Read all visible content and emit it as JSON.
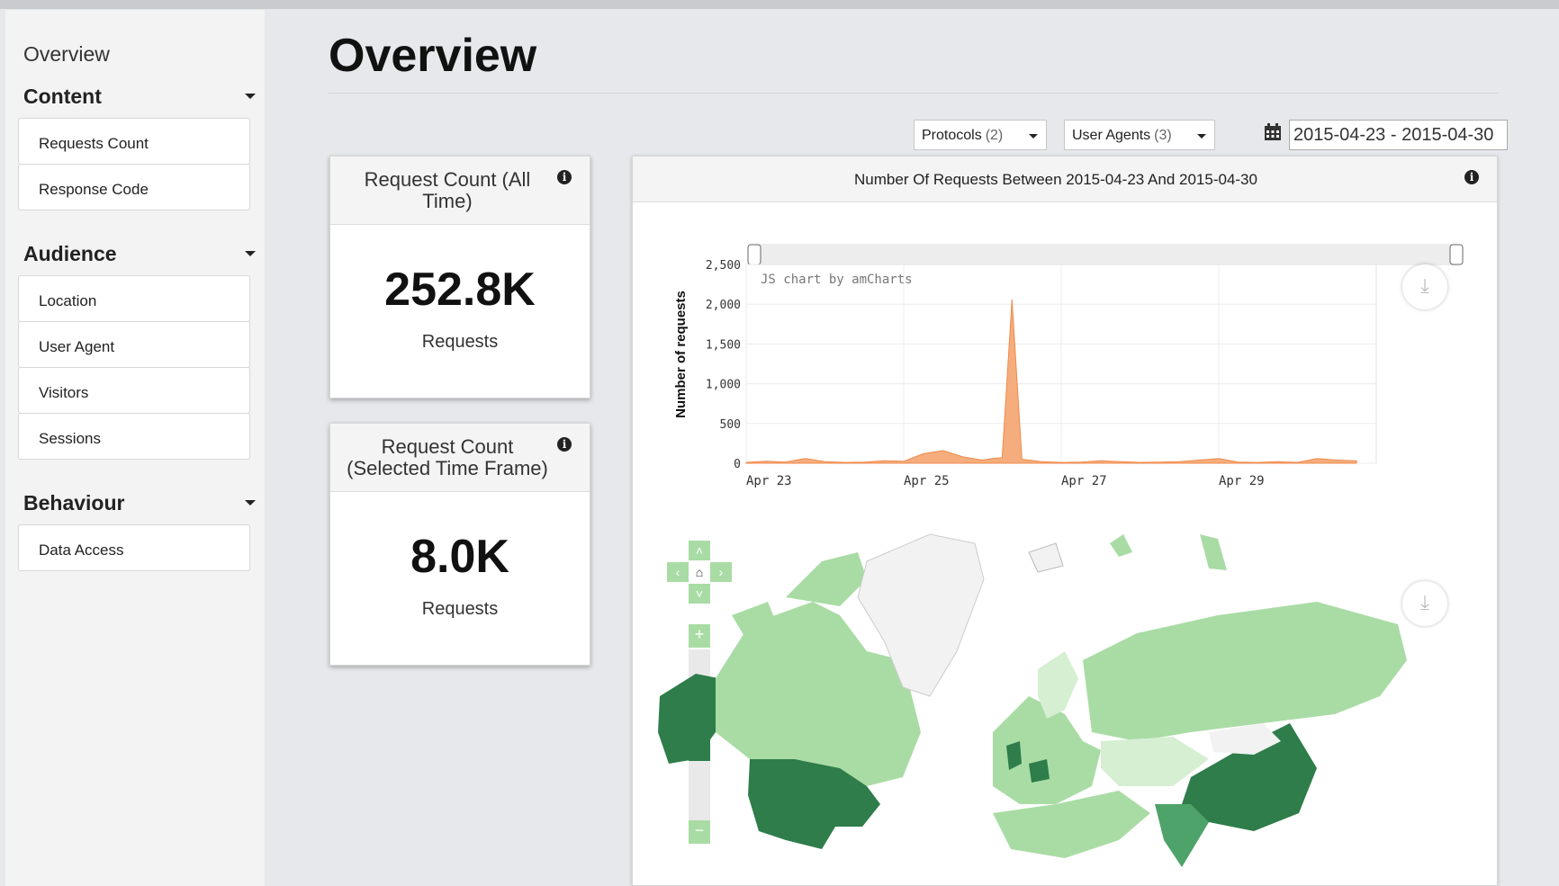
{
  "sidebar": {
    "top_link": "Overview",
    "sections": [
      {
        "title": "Content",
        "items": [
          "Requests Count",
          "Response Code"
        ]
      },
      {
        "title": "Audience",
        "items": [
          "Location",
          "User Agent",
          "Visitors",
          "Sessions"
        ]
      },
      {
        "title": "Behaviour",
        "items": [
          "Data Access"
        ]
      }
    ]
  },
  "page": {
    "title": "Overview"
  },
  "filters": {
    "protocols_label": "Protocols",
    "protocols_count": "(2)",
    "user_agents_label": "User Agents",
    "user_agents_count": "(3)",
    "date_range": "2015-04-23 - 2015-04-30"
  },
  "cards": [
    {
      "title": "Request Count (All Time)",
      "value": "252.8K",
      "label": "Requests"
    },
    {
      "title": "Request Count (Selected Time Frame)",
      "value": "8.0K",
      "label": "Requests"
    }
  ],
  "chart_panel": {
    "title": "Number Of Requests Between 2015-04-23 And 2015-04-30",
    "credit": "JS chart by amCharts"
  },
  "chart_data": {
    "type": "area",
    "title": "Number Of Requests Between 2015-04-23 And 2015-04-30",
    "xlabel": "",
    "ylabel": "Number of requests",
    "ylim": [
      0,
      2500
    ],
    "yticks": [
      "0",
      "500",
      "1,000",
      "1,500",
      "2,000",
      "2,500"
    ],
    "xticks": [
      "Apr 23",
      "Apr 25",
      "Apr 27",
      "Apr 29"
    ],
    "x": [
      "2015-04-23 00:00",
      "2015-04-23 06:00",
      "2015-04-23 12:00",
      "2015-04-23 18:00",
      "2015-04-24 00:00",
      "2015-04-24 06:00",
      "2015-04-24 12:00",
      "2015-04-24 18:00",
      "2015-04-25 00:00",
      "2015-04-25 06:00",
      "2015-04-25 12:00",
      "2015-04-25 18:00",
      "2015-04-26 00:00",
      "2015-04-26 03:00",
      "2015-04-26 06:00",
      "2015-04-26 09:00",
      "2015-04-26 12:00",
      "2015-04-26 18:00",
      "2015-04-27 00:00",
      "2015-04-27 06:00",
      "2015-04-27 12:00",
      "2015-04-27 18:00",
      "2015-04-28 00:00",
      "2015-04-28 06:00",
      "2015-04-28 12:00",
      "2015-04-28 18:00",
      "2015-04-29 00:00",
      "2015-04-29 06:00",
      "2015-04-29 12:00",
      "2015-04-29 18:00",
      "2015-04-30 00:00",
      "2015-04-30 06:00",
      "2015-04-30 12:00",
      "2015-04-30 18:00"
    ],
    "series": [
      {
        "values": [
          10,
          25,
          15,
          60,
          20,
          10,
          15,
          30,
          25,
          120,
          160,
          80,
          40,
          60,
          70,
          2060,
          50,
          20,
          10,
          15,
          30,
          20,
          10,
          15,
          20,
          40,
          60,
          15,
          10,
          20,
          10,
          60,
          40,
          30
        ],
        "color": "#f4a46f"
      }
    ],
    "grid": true
  },
  "map": {
    "colors": {
      "high": "#2e7d4a",
      "mid": "#4ea36a",
      "low": "#a9dca4",
      "none": "#f2f2f2"
    }
  },
  "icons": [
    "info-icon",
    "calendar-icon",
    "download-icon",
    "home-icon",
    "zoom-in-icon",
    "zoom-out-icon"
  ]
}
